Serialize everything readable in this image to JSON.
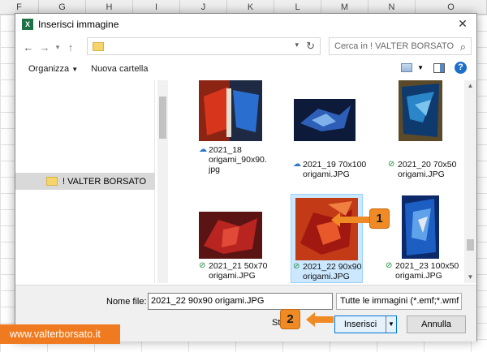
{
  "excel": {
    "columns": [
      "F",
      "G",
      "H",
      "I",
      "J",
      "K",
      "L",
      "M",
      "N",
      "O"
    ]
  },
  "dialog": {
    "title": "Inserisci immagine",
    "close_icon": "close-icon",
    "search_placeholder": "Cerca in ! VALTER BORSATO",
    "toolbar": {
      "organize_label": "Organizza",
      "new_folder_label": "Nuova cartella"
    },
    "nav_pane": {
      "selected_folder": "! VALTER BORSATO"
    },
    "files": [
      {
        "status": "cloud",
        "name": "2021_18 origami_90x90.jpg",
        "lines": [
          "2021_18",
          "origami_90x90.",
          "jpg"
        ]
      },
      {
        "status": "cloud",
        "name": "2021_19 70x100 origami.JPG",
        "lines": [
          "2021_19 70x100",
          "origami.JPG"
        ]
      },
      {
        "status": "ok",
        "name": "2021_20 70x50 origami.JPG",
        "lines": [
          "2021_20 70x50",
          "origami.JPG"
        ]
      },
      {
        "status": "ok",
        "name": "2021_21 50x70 origami.JPG",
        "lines": [
          "2021_21 50x70",
          "origami.JPG"
        ]
      },
      {
        "status": "ok",
        "name": "2021_22 90x90 origami.JPG",
        "lines": [
          "2021_22 90x90",
          "origami.JPG"
        ],
        "selected": true
      },
      {
        "status": "ok",
        "name": "2021_23 100x50 origami.JPG",
        "lines": [
          "2021_23 100x50",
          "origami.JPG"
        ]
      }
    ],
    "bottom": {
      "filename_label": "Nome file:",
      "filename_value": "2021_22 90x90 origami.JPG",
      "filter_value": "Tutte le immagini (*.emf;*.wmf",
      "tools_label": "St",
      "insert_label": "Inserisci",
      "cancel_label": "Annulla"
    }
  },
  "callouts": [
    "1",
    "2"
  ],
  "watermark": "www.valterborsato.it",
  "colors": {
    "accent": "#0078d7",
    "callout": "#f08a24",
    "banner": "#f07a1f",
    "selection": "#cce8ff"
  }
}
